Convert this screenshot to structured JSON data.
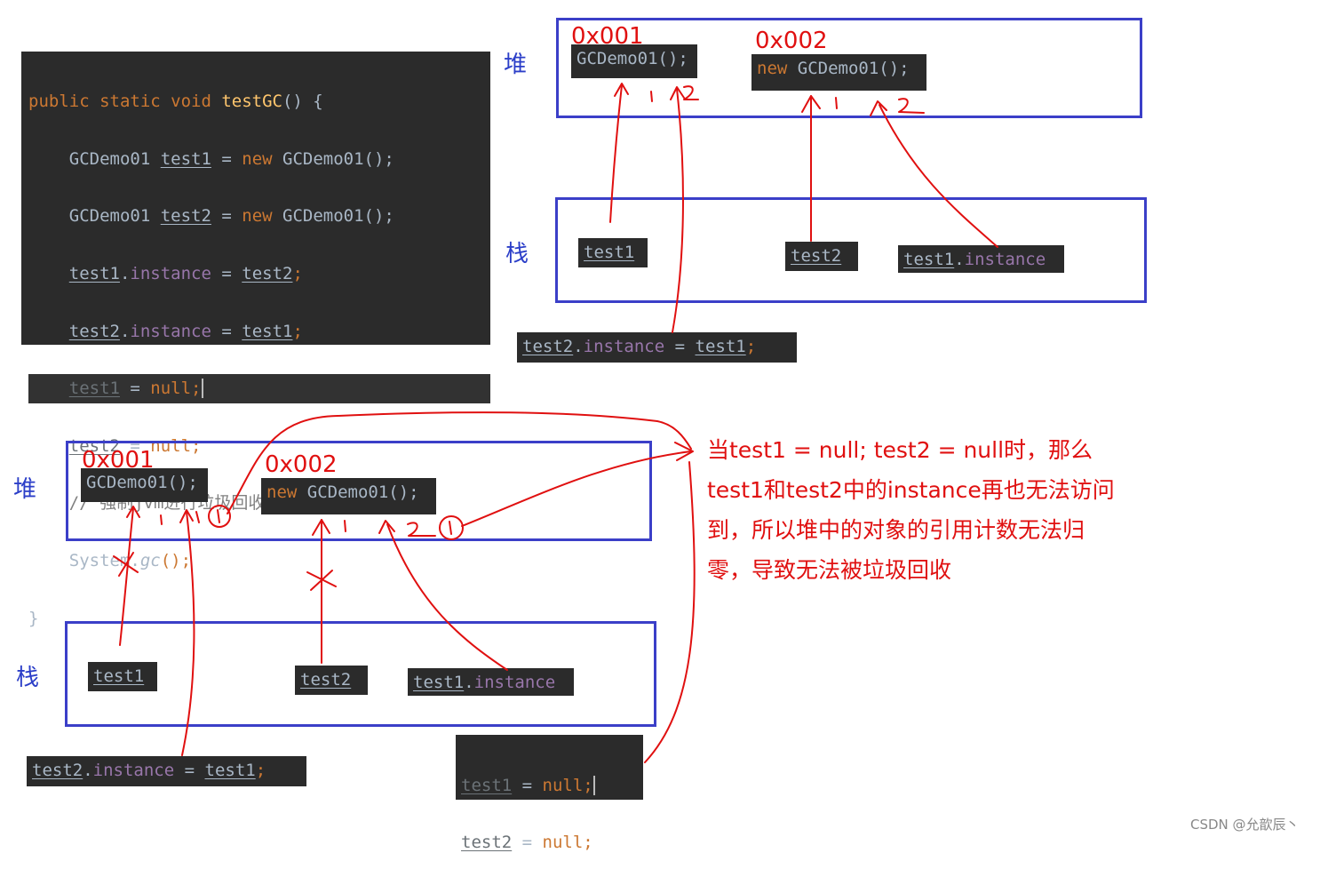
{
  "code_block": {
    "lines": [
      [
        "public static void ",
        "testGC",
        "() {"
      ],
      [
        "GCDemo01 ",
        "test1",
        " = ",
        "new",
        " GCDemo01();"
      ],
      [
        "GCDemo01 ",
        "test2",
        " = ",
        "new",
        " GCDemo01();"
      ],
      [
        "test1",
        ".",
        "instance",
        " = ",
        "test2",
        ";"
      ],
      [
        "test2",
        ".",
        "instance",
        " = ",
        "test1",
        ";"
      ],
      [
        "test1",
        " = ",
        "null;"
      ],
      [
        "test2",
        " = ",
        "null;"
      ],
      [
        "// 强制jvm进行垃圾回收"
      ],
      [
        "System.",
        "gc",
        "();"
      ],
      [
        "}"
      ]
    ]
  },
  "labels": {
    "heap": "堆",
    "stack": "栈"
  },
  "addresses": {
    "a1": "0x001",
    "a2": "0x002"
  },
  "chips": {
    "obj1": "GCDemo01();",
    "obj2_kw": "new",
    "obj2": " GCDemo01();",
    "test1": "test1",
    "test2": "test2",
    "t1_inst_a": "test1",
    "t1_inst_b": ".",
    "t1_inst_c": "instance",
    "assign_a": "test2",
    "assign_b": ".",
    "assign_c": "instance",
    "assign_d": " = ",
    "assign_e": "test1",
    "assign_f": ";",
    "null1_a": "test1",
    "null1_b": " = ",
    "null1_c": "null;",
    "null2_a": "test2",
    "null2_b": " = ",
    "null2_c": "null;"
  },
  "annotation": {
    "line1": "当test1 = null; test2 = null时，那么",
    "line2": "test1和test2中的instance再也无法访问",
    "line3": "到，所以堆中的对象的引用计数无法归",
    "line4": "零，导致无法被垃圾回收"
  },
  "handwritten": {
    "one": "1",
    "two": "2"
  },
  "credit": "CSDN @允歆辰丶",
  "colors": {
    "code_bg": "#2b2b2b",
    "keyword": "#cc7832",
    "function": "#ffc66d",
    "field": "#9876aa",
    "text": "#a9b7c6",
    "box_border": "#3b3fc8",
    "ink_red": "#e01010",
    "label_blue": "#2b3ec8"
  }
}
